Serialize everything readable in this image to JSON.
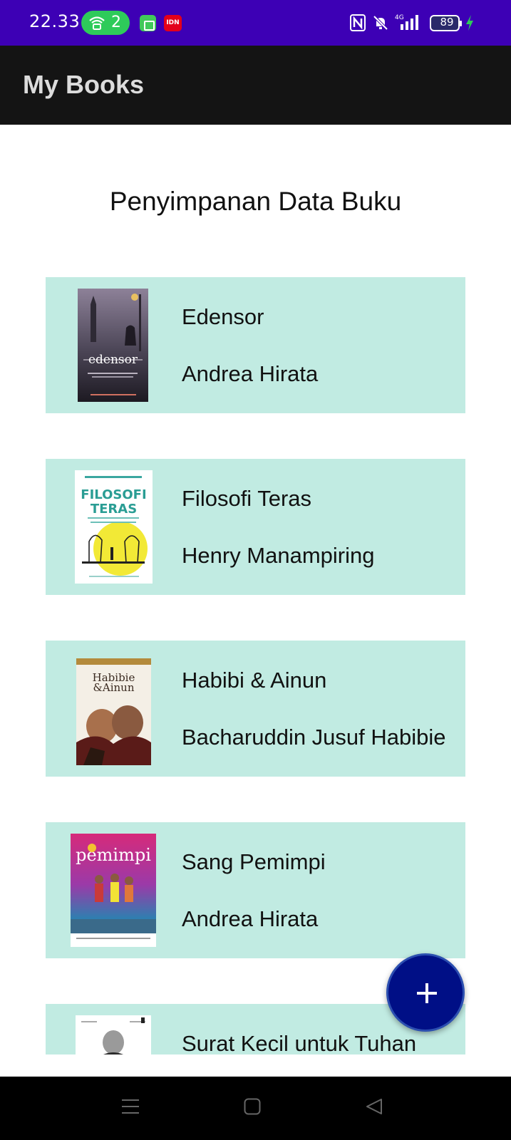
{
  "status_bar": {
    "time": "22.33",
    "hotspot_count": "2",
    "idn_label": "IDN",
    "battery_level": "89",
    "network": "4G",
    "colors": {
      "background": "#3d00b5",
      "hotspot": "#2ecb5a"
    },
    "icons": [
      "hotspot-icon",
      "app-notification-icon",
      "idn-app-icon",
      "nfc-icon",
      "mute-icon",
      "signal-icon",
      "battery-icon",
      "charging-icon"
    ]
  },
  "app_bar": {
    "title": "My Books"
  },
  "main": {
    "heading": "Penyimpanan Data Buku",
    "books": [
      {
        "title": "Edensor",
        "author": "Andrea Hirata"
      },
      {
        "title": "Filosofi Teras",
        "author": "Henry Manampiring"
      },
      {
        "title": "Habibi & Ainun",
        "author": "Bacharuddin Jusuf Habibie"
      },
      {
        "title": "Sang Pemimpi",
        "author": "Andrea Hirata"
      },
      {
        "title": "Surat Kecil untuk Tuhan",
        "author": ""
      }
    ],
    "card_color": "#c1ebe2"
  },
  "fab": {
    "icon": "plus-icon",
    "color": "#000f86"
  },
  "nav_bar": {
    "icons": [
      "menu-icon",
      "home-icon",
      "back-icon"
    ]
  }
}
